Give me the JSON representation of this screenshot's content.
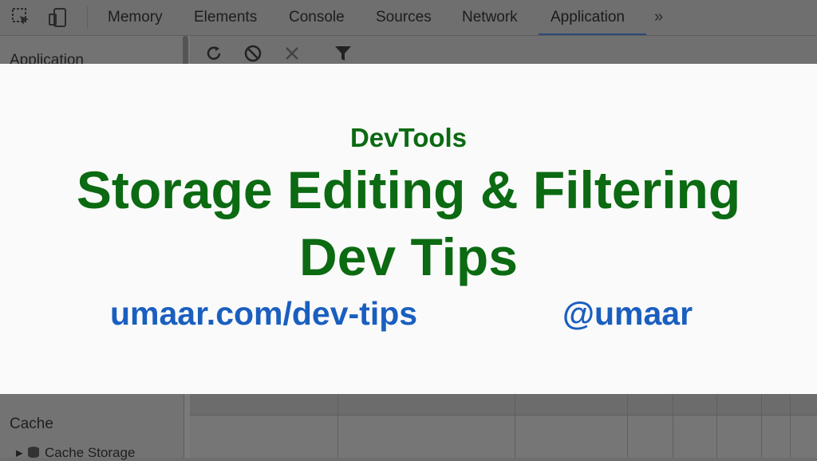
{
  "devtools": {
    "tabs": [
      "Memory",
      "Elements",
      "Console",
      "Sources",
      "Network",
      "Application"
    ],
    "active_tab": "Application",
    "more_icon": "chevron-double-right-icon",
    "sidebar": {
      "header": "Application",
      "cache_section": "Cache",
      "cache_storage": "Cache Storage"
    }
  },
  "overlay": {
    "kicker": "DevTools",
    "title": "Storage Editing & Filtering",
    "subtitle": "Dev Tips",
    "url": "umaar.com/dev-tips",
    "handle": "@umaar"
  },
  "colors": {
    "title_green": "#0b6a12",
    "link_blue": "#1a5fbf"
  }
}
